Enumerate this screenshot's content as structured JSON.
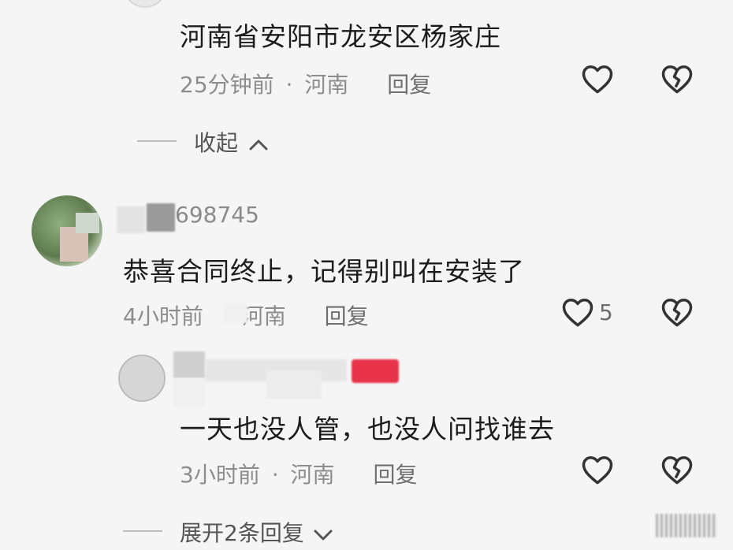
{
  "comment1": {
    "text": "河南省安阳市龙安区杨家庄",
    "time": "25分钟前",
    "sep": "·",
    "location": "河南",
    "reply": "回复"
  },
  "collapse": {
    "label": "收起"
  },
  "comment2": {
    "username": "698745",
    "text": "恭喜合同终止，记得别叫在安装了",
    "time": "4小时前",
    "location": "河南",
    "reply": "回复",
    "likes": "5"
  },
  "comment3": {
    "username": "",
    "text": "一天也没人管，也没人问找谁去",
    "time": "3小时前",
    "sep": "·",
    "location": "河南",
    "reply": "回复"
  },
  "expand": {
    "label": "展开2条回复"
  },
  "icons": {
    "like": "heart-outline-icon",
    "dislike": "broken-heart-icon",
    "chevron_up": "chevron-up-icon",
    "chevron_down": "chevron-down-icon"
  }
}
